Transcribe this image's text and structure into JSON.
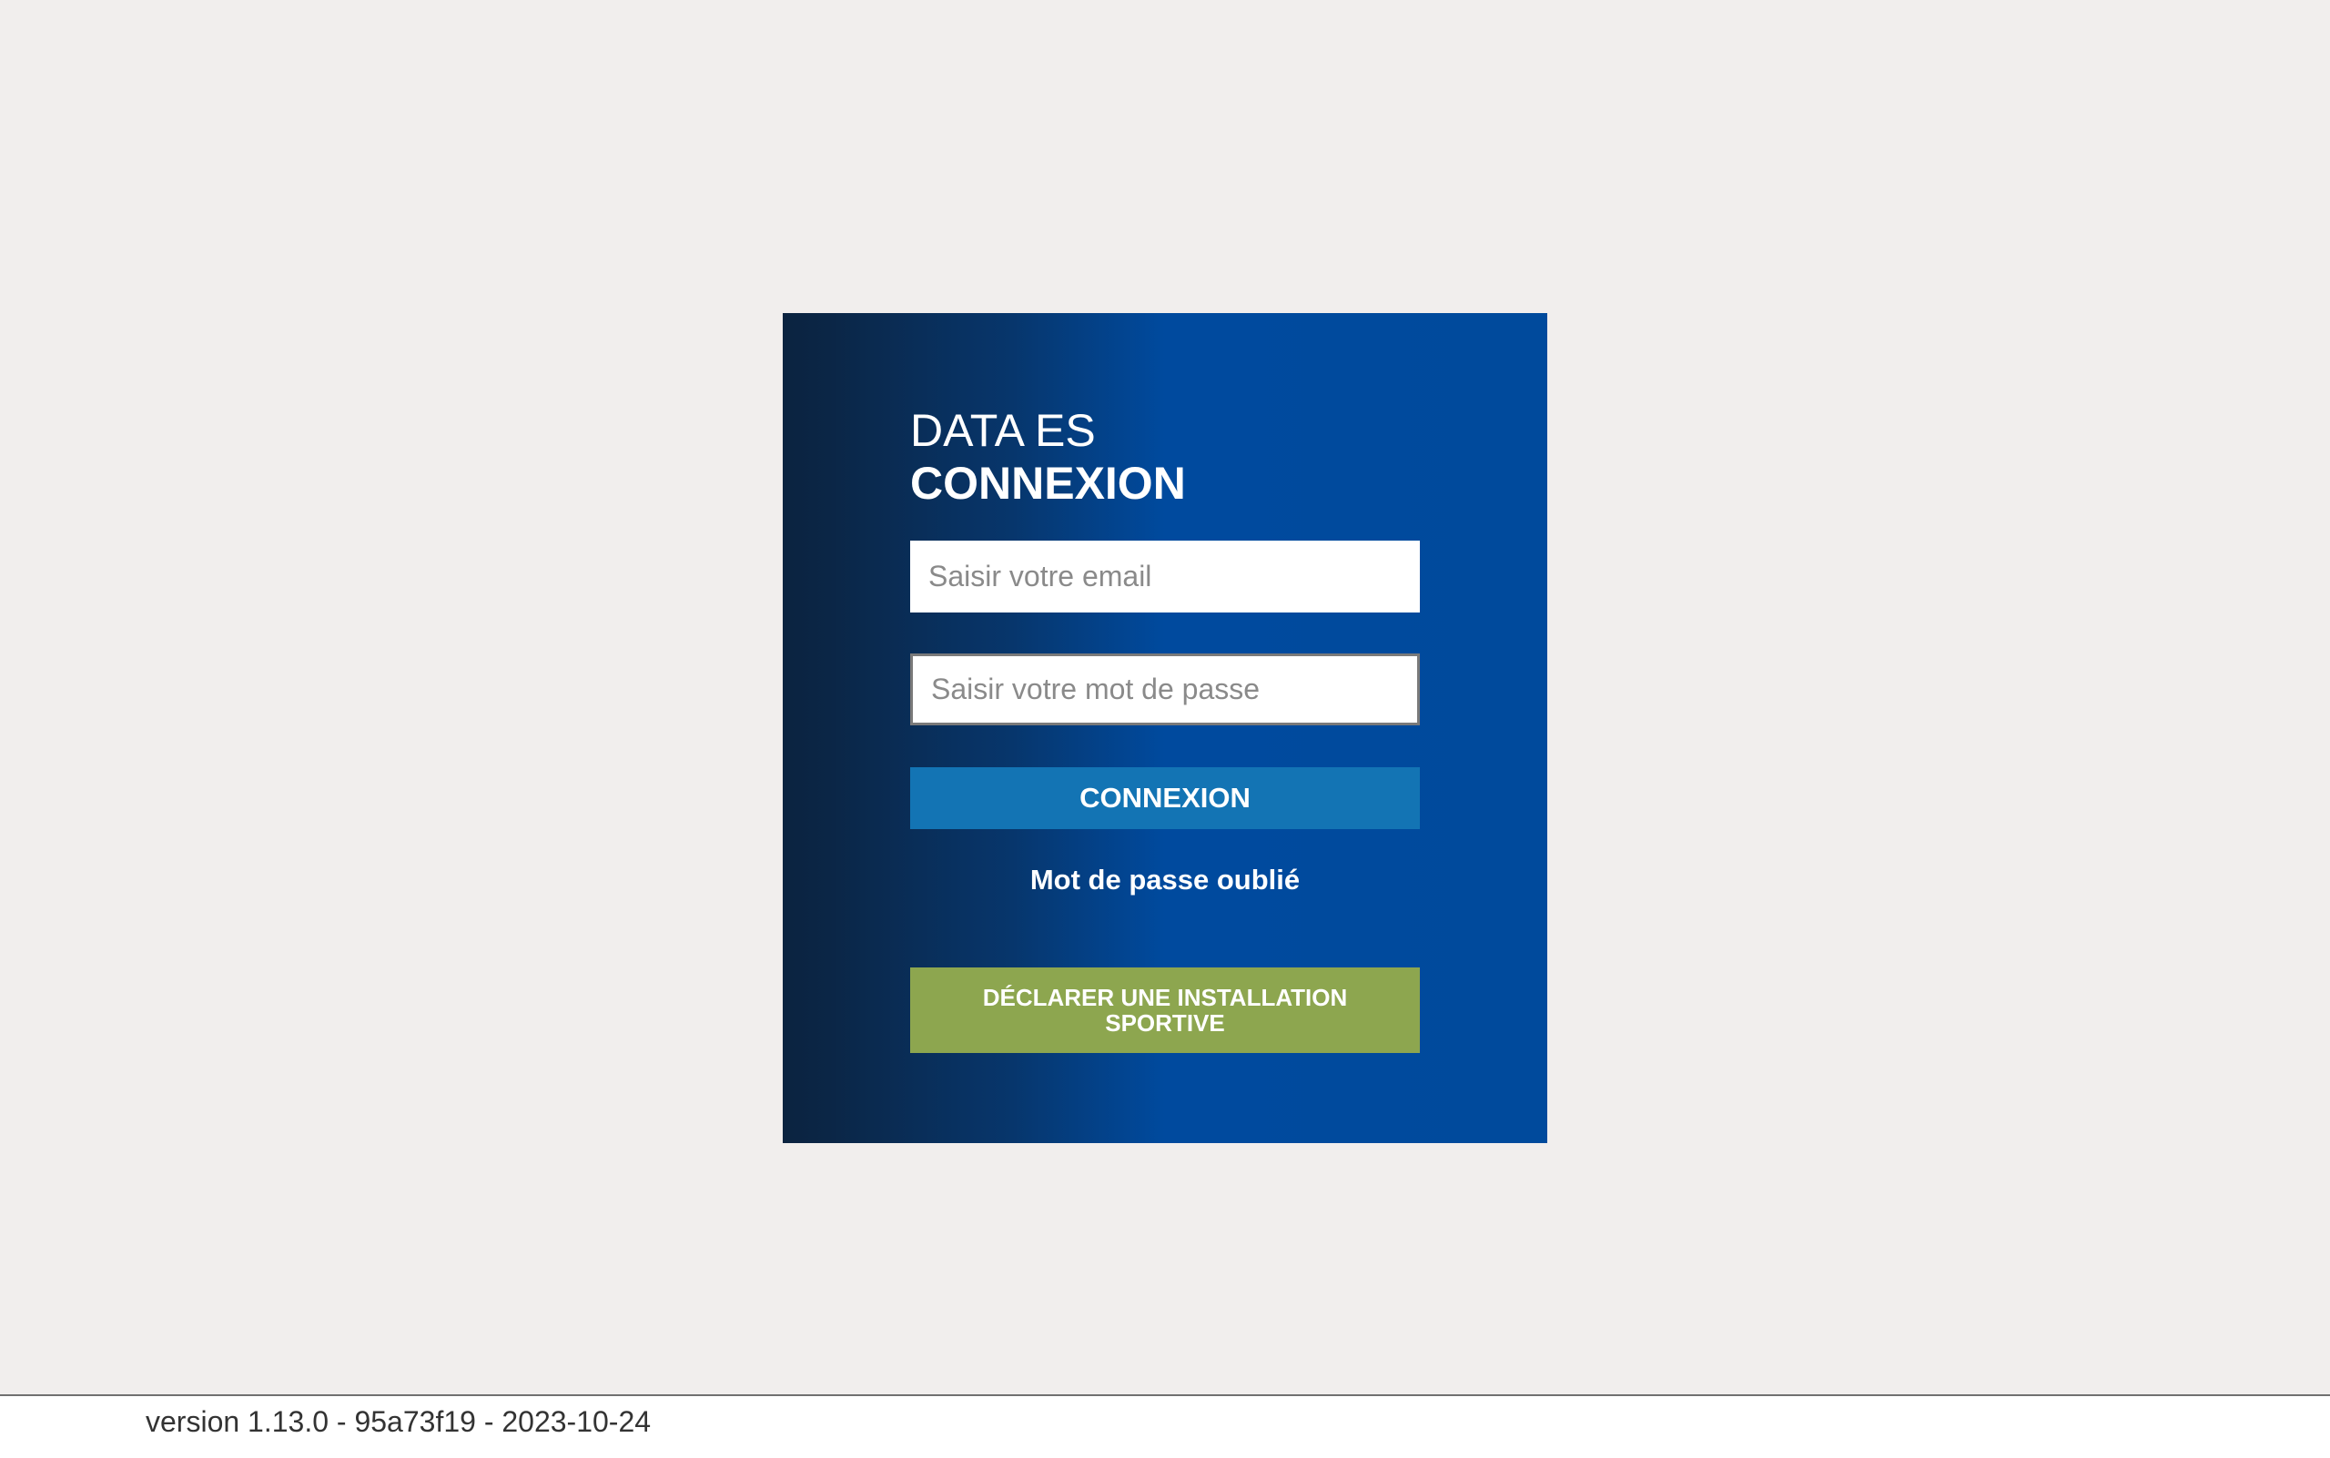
{
  "login": {
    "title_line1": "DATA ES",
    "title_line2": "CONNEXION",
    "email_placeholder": "Saisir votre email",
    "email_value": "",
    "password_placeholder": "Saisir votre mot de passe",
    "password_value": "",
    "login_button": "CONNEXION",
    "forgot_password": "Mot de passe oublié",
    "declare_button": "DÉCLARER UNE INSTALLATION SPORTIVE"
  },
  "footer": {
    "version": "version 1.13.0 - 95a73f19 - 2023-10-24"
  },
  "colors": {
    "background": "#f1eeed",
    "card_dark": "#0b2340",
    "card_blue": "#004a9c",
    "login_button": "#1374b4",
    "declare_button": "#8da64f"
  }
}
